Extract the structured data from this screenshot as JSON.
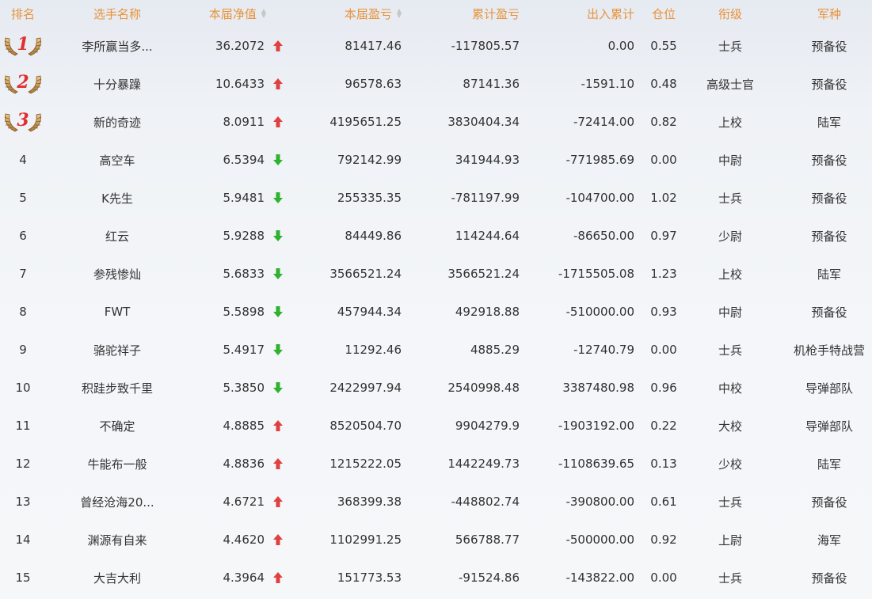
{
  "header": {
    "rank": "排名",
    "name": "选手名称",
    "nav": "本届净值",
    "pnl": "本届盈亏",
    "cum_pnl": "累计盈亏",
    "flow": "出入累计",
    "position": "仓位",
    "military_rank": "衔级",
    "arm": "军种"
  },
  "colors": {
    "header_text": "#e8933a",
    "up": "#e04040",
    "down": "#2fb22f",
    "medal_number": "#e02f2f"
  },
  "rows": [
    {
      "rank": "1",
      "medal": true,
      "name": "李所赢当多...",
      "nav": "36.2072",
      "trend": "up",
      "pnl": "81417.46",
      "cum_pnl": "-117805.57",
      "flow": "0.00",
      "position": "0.55",
      "military_rank": "士兵",
      "arm": "预备役"
    },
    {
      "rank": "2",
      "medal": true,
      "name": "十分暴躁",
      "nav": "10.6433",
      "trend": "up",
      "pnl": "96578.63",
      "cum_pnl": "87141.36",
      "flow": "-1591.10",
      "position": "0.48",
      "military_rank": "高级士官",
      "arm": "预备役"
    },
    {
      "rank": "3",
      "medal": true,
      "name": "新的奇迹",
      "nav": "8.0911",
      "trend": "up",
      "pnl": "4195651.25",
      "cum_pnl": "3830404.34",
      "flow": "-72414.00",
      "position": "0.82",
      "military_rank": "上校",
      "arm": "陆军"
    },
    {
      "rank": "4",
      "medal": false,
      "name": "高空车",
      "nav": "6.5394",
      "trend": "down",
      "pnl": "792142.99",
      "cum_pnl": "341944.93",
      "flow": "-771985.69",
      "position": "0.00",
      "military_rank": "中尉",
      "arm": "预备役"
    },
    {
      "rank": "5",
      "medal": false,
      "name": "K先生",
      "nav": "5.9481",
      "trend": "down",
      "pnl": "255335.35",
      "cum_pnl": "-781197.99",
      "flow": "-104700.00",
      "position": "1.02",
      "military_rank": "士兵",
      "arm": "预备役"
    },
    {
      "rank": "6",
      "medal": false,
      "name": "红云",
      "nav": "5.9288",
      "trend": "down",
      "pnl": "84449.86",
      "cum_pnl": "114244.64",
      "flow": "-86650.00",
      "position": "0.97",
      "military_rank": "少尉",
      "arm": "预备役"
    },
    {
      "rank": "7",
      "medal": false,
      "name": "参残惨灿",
      "nav": "5.6833",
      "trend": "down",
      "pnl": "3566521.24",
      "cum_pnl": "3566521.24",
      "flow": "-1715505.08",
      "position": "1.23",
      "military_rank": "上校",
      "arm": "陆军"
    },
    {
      "rank": "8",
      "medal": false,
      "name": "FWT",
      "nav": "5.5898",
      "trend": "down",
      "pnl": "457944.34",
      "cum_pnl": "492918.88",
      "flow": "-510000.00",
      "position": "0.93",
      "military_rank": "中尉",
      "arm": "预备役"
    },
    {
      "rank": "9",
      "medal": false,
      "name": "骆驼祥子",
      "nav": "5.4917",
      "trend": "down",
      "pnl": "11292.46",
      "cum_pnl": "4885.29",
      "flow": "-12740.79",
      "position": "0.00",
      "military_rank": "士兵",
      "arm": "机枪手特战营"
    },
    {
      "rank": "10",
      "medal": false,
      "name": "积跬步致千里",
      "nav": "5.3850",
      "trend": "down",
      "pnl": "2422997.94",
      "cum_pnl": "2540998.48",
      "flow": "3387480.98",
      "position": "0.96",
      "military_rank": "中校",
      "arm": "导弹部队"
    },
    {
      "rank": "11",
      "medal": false,
      "name": "不确定",
      "nav": "4.8885",
      "trend": "up",
      "pnl": "8520504.70",
      "cum_pnl": "9904279.9",
      "flow": "-1903192.00",
      "position": "0.22",
      "military_rank": "大校",
      "arm": "导弹部队"
    },
    {
      "rank": "12",
      "medal": false,
      "name": "牛能布一般",
      "nav": "4.8836",
      "trend": "up",
      "pnl": "1215222.05",
      "cum_pnl": "1442249.73",
      "flow": "-1108639.65",
      "position": "0.13",
      "military_rank": "少校",
      "arm": "陆军"
    },
    {
      "rank": "13",
      "medal": false,
      "name": "曾经沧海20...",
      "nav": "4.6721",
      "trend": "up",
      "pnl": "368399.38",
      "cum_pnl": "-448802.74",
      "flow": "-390800.00",
      "position": "0.61",
      "military_rank": "士兵",
      "arm": "预备役"
    },
    {
      "rank": "14",
      "medal": false,
      "name": "渊源有自来",
      "nav": "4.4620",
      "trend": "up",
      "pnl": "1102991.25",
      "cum_pnl": "566788.77",
      "flow": "-500000.00",
      "position": "0.92",
      "military_rank": "上尉",
      "arm": "海军"
    },
    {
      "rank": "15",
      "medal": false,
      "name": "大吉大利",
      "nav": "4.3964",
      "trend": "up",
      "pnl": "151773.53",
      "cum_pnl": "-91524.86",
      "flow": "-143822.00",
      "position": "0.00",
      "military_rank": "士兵",
      "arm": "预备役"
    }
  ]
}
